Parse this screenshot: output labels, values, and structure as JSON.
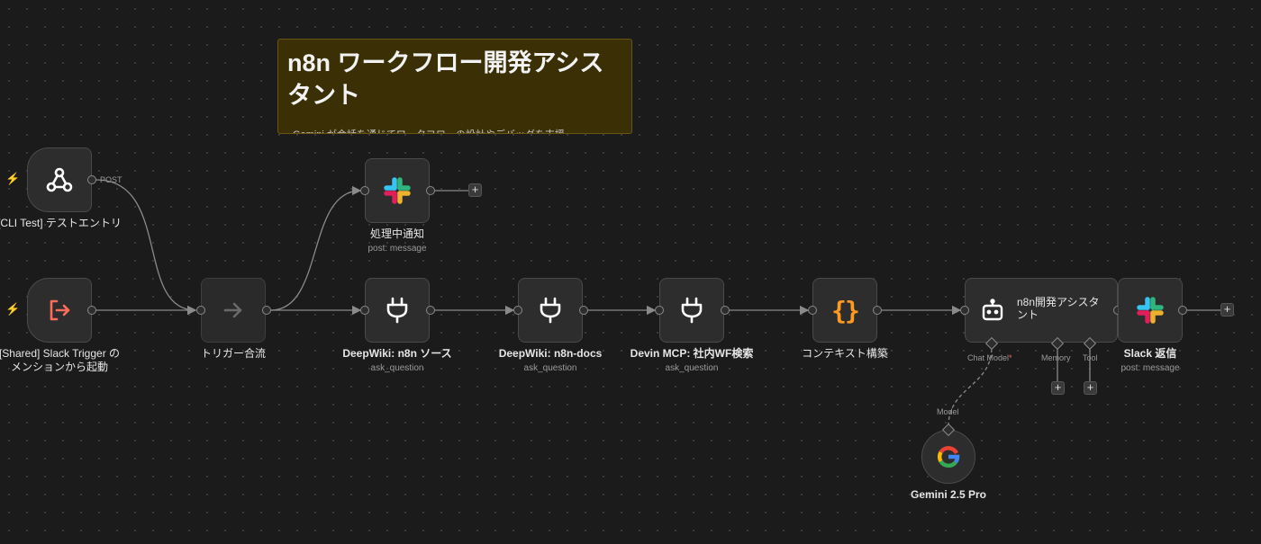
{
  "sticky_note": {
    "title": "n8n ワークフロー開発アシスタント",
    "body_preview": "Gemini が会話を通じてワークフローの設計やデバッグを支援"
  },
  "nodes": {
    "cli_test": {
      "label": "[CLI Test] テストエントリ",
      "output_label": "POST",
      "icon": "webhook-icon"
    },
    "slack_trigger": {
      "label_line1": "[Shared] Slack Trigger の",
      "label_line2": "メンションから起動",
      "icon": "sign-out-arrow-icon"
    },
    "merge": {
      "label": "トリガー合流",
      "icon": "arrow-right-icon"
    },
    "notify": {
      "label": "処理中通知",
      "sublabel": "post: message",
      "icon": "slack-icon"
    },
    "deepwiki_n8n": {
      "label": "DeepWiki: n8n ソース",
      "sublabel": "ask_question",
      "icon": "plug-icon"
    },
    "deepwiki_docs": {
      "label": "DeepWiki: n8n-docs",
      "sublabel": "ask_question",
      "icon": "plug-icon"
    },
    "devin_mcp": {
      "label": "Devin MCP: 社内WF検索",
      "sublabel": "ask_question",
      "icon": "plug-icon"
    },
    "context": {
      "label": "コンテキスト構築",
      "icon": "curly-braces-icon"
    },
    "agent": {
      "title": "n8n開発アシスタント",
      "icon": "robot-icon",
      "ports": {
        "chat_model": "Chat Model",
        "required_mark": "*",
        "memory": "Memory",
        "tool": "Tool"
      }
    },
    "slack_reply": {
      "label": "Slack 返信",
      "sublabel": "post: message",
      "icon": "slack-icon"
    },
    "gemini": {
      "label": "Gemini 2.5 Pro",
      "port_label": "Model",
      "icon": "google-g-icon"
    }
  },
  "ui": {
    "add_symbol": "+",
    "trigger_symbol": "⚡"
  },
  "colors": {
    "canvas": "#1b1b1b",
    "node": "#2d2d2d",
    "trigger_bolt": "#ff6d5a",
    "code_orange": "#ff9922",
    "sticky_yellow": "#3a2f05"
  }
}
